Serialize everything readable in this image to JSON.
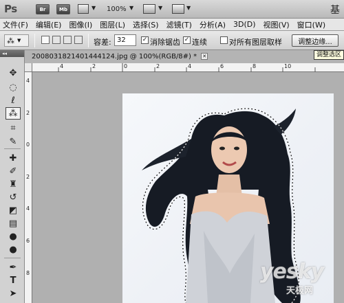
{
  "app": {
    "logo": "Ps",
    "bridge_label": "Br",
    "minibridge_label": "Mb",
    "zoom": "100%",
    "corner_glyph": "基"
  },
  "menu": [
    "文件(F)",
    "编辑(E)",
    "图像(I)",
    "图层(L)",
    "选择(S)",
    "滤镜(T)",
    "分析(A)",
    "3D(D)",
    "视图(V)",
    "窗口(W)"
  ],
  "options": {
    "tolerance_label": "容差:",
    "tolerance_value": "32",
    "anti_alias_label": "消除锯齿",
    "anti_alias_checked": true,
    "contiguous_label": "连续",
    "contiguous_checked": true,
    "sample_all_label": "对所有图层取样",
    "sample_all_checked": false,
    "refine_edge_label": "调整边缘...",
    "tooltip": "调整选区"
  },
  "document": {
    "tab_title": "2008031821401444124.jpg @ 100%(RGB/8#) *",
    "ruler_h": [
      "4",
      "2",
      "0",
      "2",
      "4",
      "6",
      "8",
      "10"
    ],
    "ruler_v": [
      "4",
      "2",
      "0",
      "2",
      "4",
      "6",
      "8"
    ]
  },
  "watermark": {
    "brand": "yesky",
    "sub": "天极网"
  },
  "colors": {
    "hair": "#161b24",
    "skin": "#e9c5ad",
    "dress": "#cfd2d8",
    "canvas": "#b0b0b0",
    "photo_bg": "#f2f4f8"
  },
  "tools_panel": [
    "move-tool",
    "marquee-tool",
    "lasso-tool",
    "quick-selection-tool",
    "crop-tool",
    "eyedropper-tool",
    "healing-brush-tool",
    "brush-tool",
    "clone-stamp-tool",
    "history-brush-tool",
    "eraser-tool",
    "gradient-tool",
    "blur-tool",
    "dodge-tool",
    "pen-tool",
    "type-tool",
    "path-selection-tool"
  ]
}
